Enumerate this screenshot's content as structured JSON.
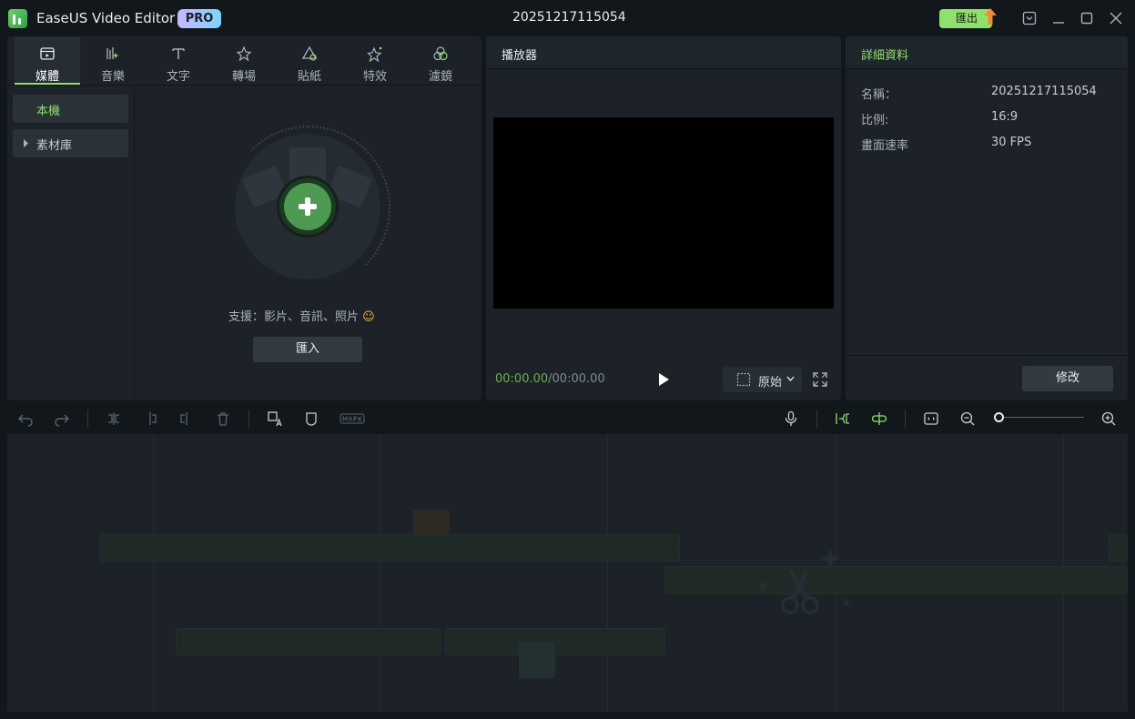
{
  "app": {
    "name": "EaseUS Video Editor",
    "badge": "PRO",
    "project_title": "20251217115054",
    "export_label": "匯出"
  },
  "media_panel": {
    "tabs": [
      {
        "label": "媒體",
        "icon": "media-icon",
        "active": true
      },
      {
        "label": "音樂",
        "icon": "music-icon",
        "active": false
      },
      {
        "label": "文字",
        "icon": "text-icon",
        "active": false
      },
      {
        "label": "轉場",
        "icon": "transition-icon",
        "active": false
      },
      {
        "label": "貼紙",
        "icon": "sticker-icon",
        "active": false
      },
      {
        "label": "特效",
        "icon": "effects-icon",
        "active": false
      },
      {
        "label": "濾鏡",
        "icon": "filter-icon",
        "active": false
      }
    ],
    "sidebar": {
      "local": "本機",
      "library": "素材庫"
    },
    "support_text": "支援：影片、音訊、照片",
    "import_label": "匯入"
  },
  "player": {
    "title": "播放器",
    "current_time": "00:00.00",
    "total_time": "/00:00.00",
    "ratio_label": "原始"
  },
  "details": {
    "title": "詳細資料",
    "rows": [
      {
        "label": "名稱：",
        "value": "20251217115054"
      },
      {
        "label": "比例:",
        "value": "16:9"
      },
      {
        "label": "畫面速率",
        "value": "30 FPS"
      }
    ],
    "modify_label": "修改"
  },
  "colors": {
    "accent": "#8fe06d",
    "panel": "#1c2227",
    "background": "#12171c"
  }
}
